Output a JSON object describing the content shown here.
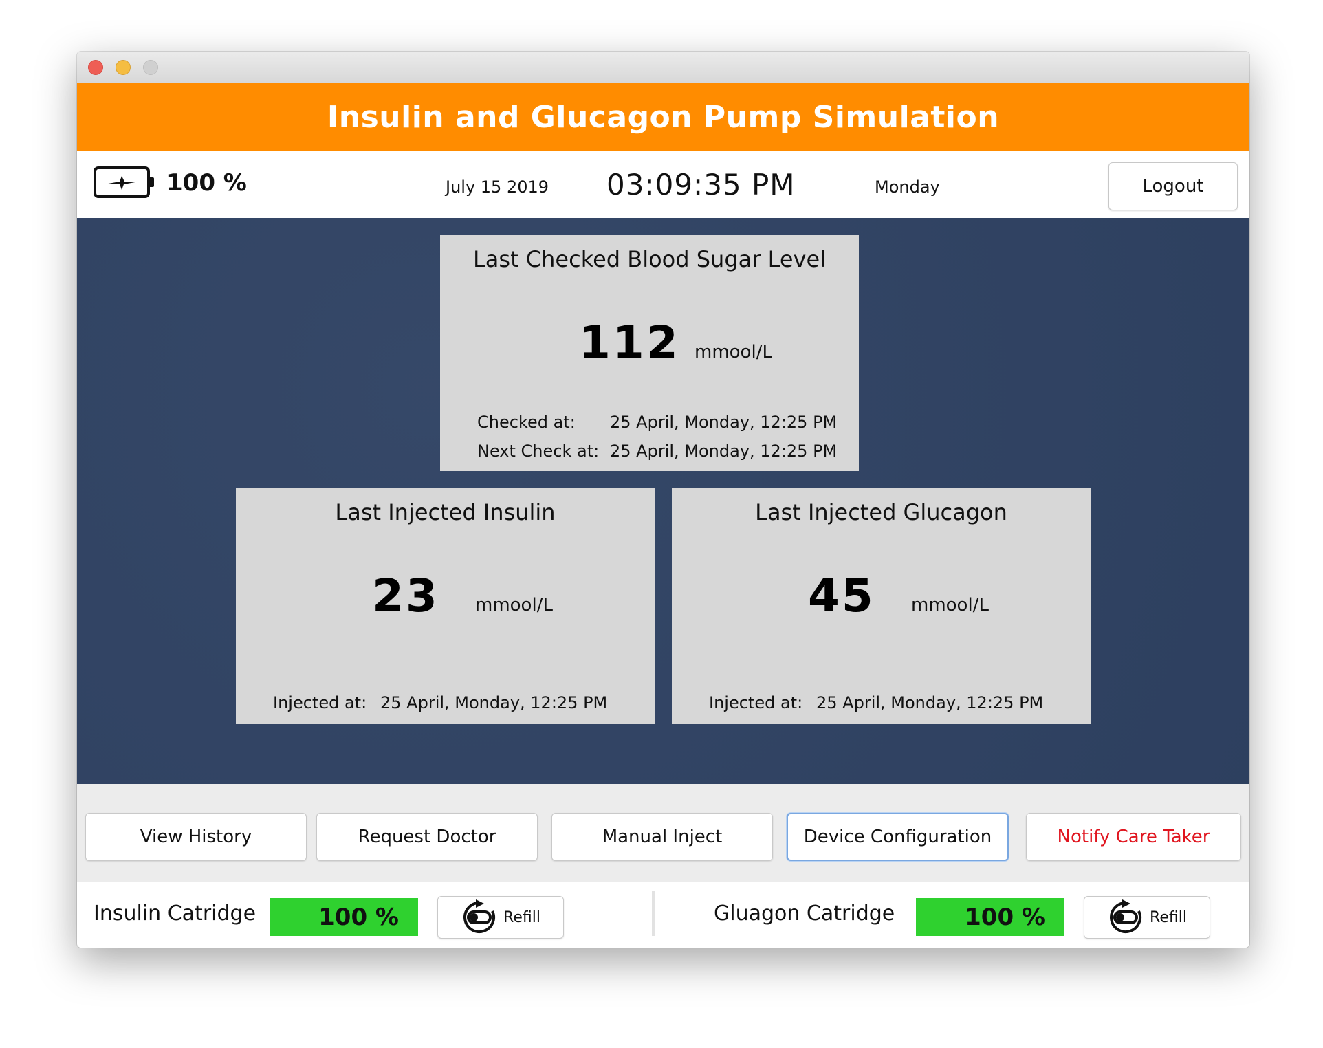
{
  "window": {
    "title": "Insulin and Glucagon Pump Simulation"
  },
  "status": {
    "battery_icon": "battery-charging-icon",
    "battery_percent": "100 %",
    "date": "July 15 2019",
    "time": "03:09:35 PM",
    "day": "Monday",
    "logout_label": "Logout"
  },
  "blood_sugar": {
    "title": "Last Checked Blood Sugar Level",
    "value": "112",
    "unit": "mmool/L",
    "checked_label": "Checked at:",
    "checked_value": "25 April, Monday, 12:25 PM",
    "next_label": "Next Check at:",
    "next_value": "25 April, Monday, 12:25 PM"
  },
  "insulin": {
    "title": "Last Injected Insulin",
    "value": "23",
    "unit": "mmool/L",
    "injected_label": "Injected at:",
    "injected_value": "25 April, Monday, 12:25 PM"
  },
  "glucagon": {
    "title": "Last Injected Glucagon",
    "value": "45",
    "unit": "mmool/L",
    "injected_label": "Injected at:",
    "injected_value": "25 April, Monday, 12:25 PM"
  },
  "actions": {
    "view_history": "View History",
    "request_doctor": "Request Doctor",
    "manual_inject": "Manual Inject",
    "device_configuration": "Device Configuration",
    "notify_care_taker": "Notify Care Taker"
  },
  "cartridges": {
    "insulin_label": "Insulin Catridge",
    "insulin_level": "100 %",
    "insulin_refill": "Refill",
    "glucagon_label": "Gluagon Catridge",
    "glucagon_level": "100 %",
    "glucagon_refill": "Refill",
    "refill_icon": "refill-icon"
  },
  "colors": {
    "header_accent": "#ff8c00",
    "panel_background": "#2f4263",
    "card_background": "#d7d7d7",
    "level_fill": "#2fd12f",
    "danger_text": "#e0141e",
    "focus_ring": "#7aa7e0"
  }
}
